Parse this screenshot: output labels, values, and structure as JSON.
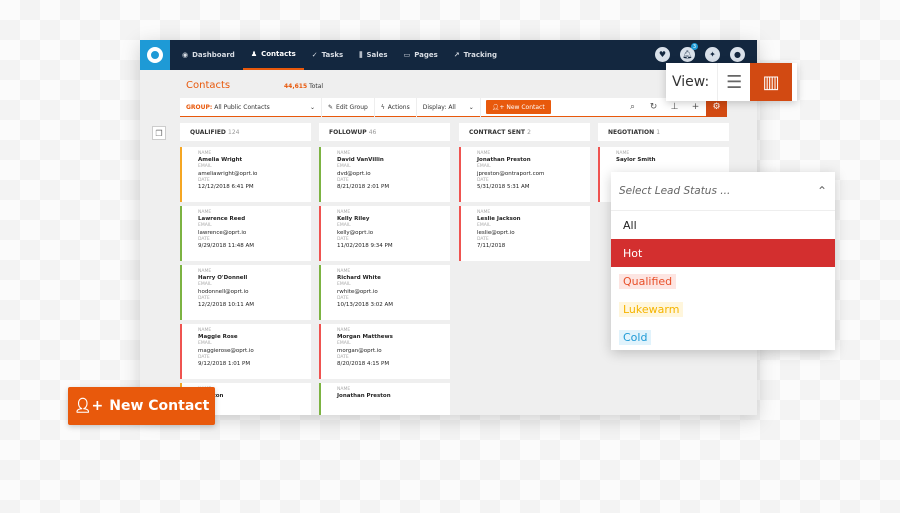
{
  "nav": {
    "items": [
      {
        "label": "Dashboard",
        "icon": "dashboard-icon"
      },
      {
        "label": "Contacts",
        "icon": "person-icon",
        "active": true
      },
      {
        "label": "Tasks",
        "icon": "check-icon"
      },
      {
        "label": "Sales",
        "icon": "bar-chart-icon"
      },
      {
        "label": "Pages",
        "icon": "page-icon"
      },
      {
        "label": "Tracking",
        "icon": "tracking-icon"
      }
    ],
    "notification_count": "3"
  },
  "header": {
    "title": "Contacts",
    "total_count": "44,615",
    "total_label": "Total"
  },
  "toolbar": {
    "group_label": "GROUP:",
    "group_value": "All Public Contacts",
    "edit_group": "Edit Group",
    "actions": "Actions",
    "display": "Display: All",
    "new_contact": "New Contact"
  },
  "view": {
    "label": "View:"
  },
  "columns": [
    {
      "title": "QUALIFIED",
      "count": "124",
      "cards": [
        {
          "name": "Amelia Wright",
          "email": "ameliawright@oprt.io",
          "date": "12/12/2018 6:41 PM",
          "color": "#f5a623"
        },
        {
          "name": "Lawrence Reed",
          "email": "lawrence@oprt.io",
          "date": "9/29/2018 11:48 AM",
          "color": "#7cb342"
        },
        {
          "name": "Harry O'Donnell",
          "email": "hodonnell@oprt.io",
          "date": "12/2/2018 10:11 AM",
          "color": "#7cb342"
        },
        {
          "name": "Maggie Rose",
          "email": "maggierose@oprt.io",
          "date": "9/12/2018 1:01 PM",
          "color": "#ef5350"
        },
        {
          "name": "Winston",
          "email": "",
          "date": "",
          "color": "#f5a623"
        }
      ]
    },
    {
      "title": "FOLLOWUP",
      "count": "46",
      "cards": [
        {
          "name": "David VanVillin",
          "email": "dvd@oprt.io",
          "date": "8/21/2018 2:01 PM",
          "color": "#7cb342"
        },
        {
          "name": "Kelly Riley",
          "email": "kelly@oprt.io",
          "date": "11/02/2018 9:34 PM",
          "color": "#ef5350"
        },
        {
          "name": "Richard White",
          "email": "rwhite@oprt.io",
          "date": "10/13/2018 3:02 AM",
          "color": "#7cb342"
        },
        {
          "name": "Morgan Matthews",
          "email": "morgan@oprt.io",
          "date": "8/20/2018 4:15 PM",
          "color": "#ef5350"
        },
        {
          "name": "Jonathan Preston",
          "email": "",
          "date": "",
          "color": "#7cb342"
        }
      ]
    },
    {
      "title": "CONTRACT SENT",
      "count": "2",
      "cards": [
        {
          "name": "Jonathan Preston",
          "email": "jpreston@ontraport.com",
          "date": "5/31/2018 5:31 AM",
          "color": "#ef5350"
        },
        {
          "name": "Leslie Jackson",
          "email": "leslie@oprt.io",
          "date": "7/11/2018",
          "color": "#ef5350"
        }
      ]
    },
    {
      "title": "NEGOTIATION",
      "count": "1",
      "cards": [
        {
          "name": "Saylor Smith",
          "email": "",
          "date": "",
          "color": "#ef5350"
        }
      ]
    }
  ],
  "field_labels": {
    "name": "NAME",
    "email": "EMAIL",
    "date": "DATE"
  },
  "lead_status": {
    "placeholder": "Select Lead Status ...",
    "options": [
      {
        "label": "All"
      },
      {
        "label": "Hot",
        "selected": true
      },
      {
        "label": "Qualified",
        "color": "#e8502a",
        "bg": "#fde5e2"
      },
      {
        "label": "Lukewarm",
        "color": "#f5b400",
        "bg": "#fff6dc"
      },
      {
        "label": "Cold",
        "color": "#1e9ad6",
        "bg": "#e1f3fc"
      }
    ]
  },
  "floating_button": {
    "label": "New Contact"
  }
}
